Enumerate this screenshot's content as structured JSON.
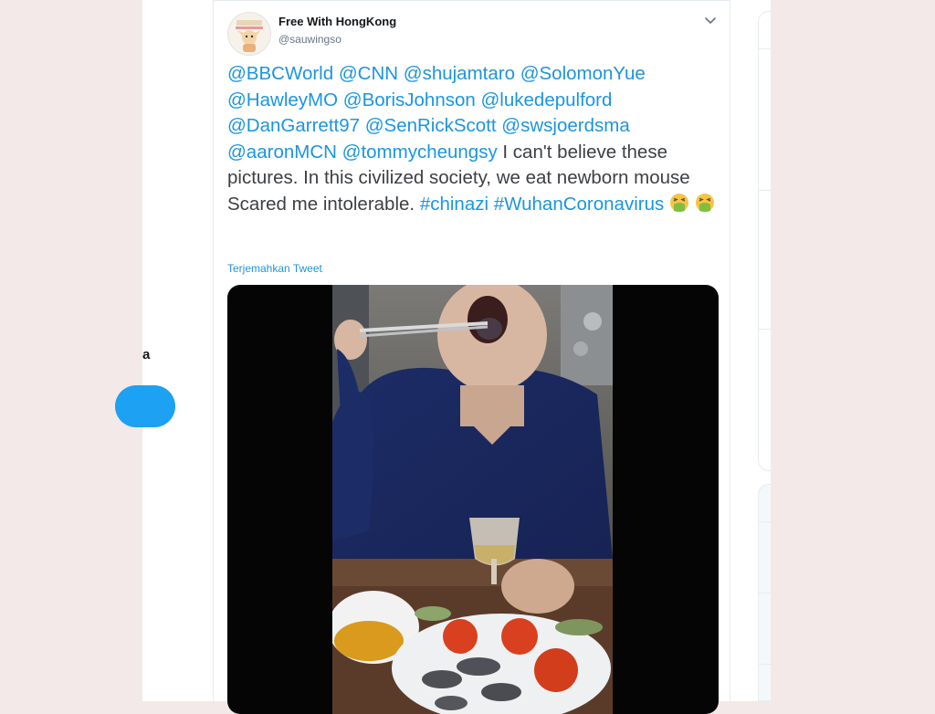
{
  "left_nav": {
    "fragment_text": "a"
  },
  "tweet": {
    "author": {
      "display_name": "Free With HongKong",
      "handle": "@sauwingso"
    },
    "text_segments": [
      {
        "type": "mention",
        "text": "@BBCWorld"
      },
      {
        "type": "plain",
        "text": " "
      },
      {
        "type": "mention",
        "text": "@CNN"
      },
      {
        "type": "plain",
        "text": " "
      },
      {
        "type": "mention",
        "text": "@shujamtaro"
      },
      {
        "type": "plain",
        "text": " "
      },
      {
        "type": "mention",
        "text": "@SolomonYue"
      },
      {
        "type": "plain",
        "text": " "
      },
      {
        "type": "mention",
        "text": "@HawleyMO"
      },
      {
        "type": "plain",
        "text": " "
      },
      {
        "type": "mention",
        "text": "@BorisJohnson"
      },
      {
        "type": "plain",
        "text": " "
      },
      {
        "type": "mention",
        "text": "@lukedepulford"
      },
      {
        "type": "plain",
        "text": " "
      },
      {
        "type": "mention",
        "text": "@DanGarrett97"
      },
      {
        "type": "plain",
        "text": " "
      },
      {
        "type": "mention",
        "text": "@SenRickScott"
      },
      {
        "type": "plain",
        "text": " "
      },
      {
        "type": "mention",
        "text": "@swsjoerdsma"
      },
      {
        "type": "plain",
        "text": " "
      },
      {
        "type": "mention",
        "text": "@aaronMCN"
      },
      {
        "type": "plain",
        "text": " "
      },
      {
        "type": "mention",
        "text": "@tommycheungsy"
      },
      {
        "type": "plain",
        "text": " I can't believe these pictures. In this civilized society, we eat newborn mouse Scared me intolerable. "
      },
      {
        "type": "hashtag",
        "text": "#chinazi"
      },
      {
        "type": "plain",
        "text": " "
      },
      {
        "type": "hashtag",
        "text": "#WuhanCoronavirus"
      },
      {
        "type": "plain",
        "text": " "
      },
      {
        "type": "emoji",
        "name": "face-vomiting-icon"
      },
      {
        "type": "plain",
        "text": " "
      },
      {
        "type": "emoji",
        "name": "face-vomiting-icon"
      }
    ],
    "translate_label": "Terjemahkan Tweet",
    "icons": {
      "more": "chevron-down-icon",
      "avatar": "avatar-cartoon-icon"
    },
    "media": {
      "description_icon": "video-frame"
    }
  },
  "colors": {
    "link": "#1b95e0",
    "primary_button": "#1da1f2",
    "page_background": "#f3e9e8",
    "text": "#3c3f43"
  }
}
